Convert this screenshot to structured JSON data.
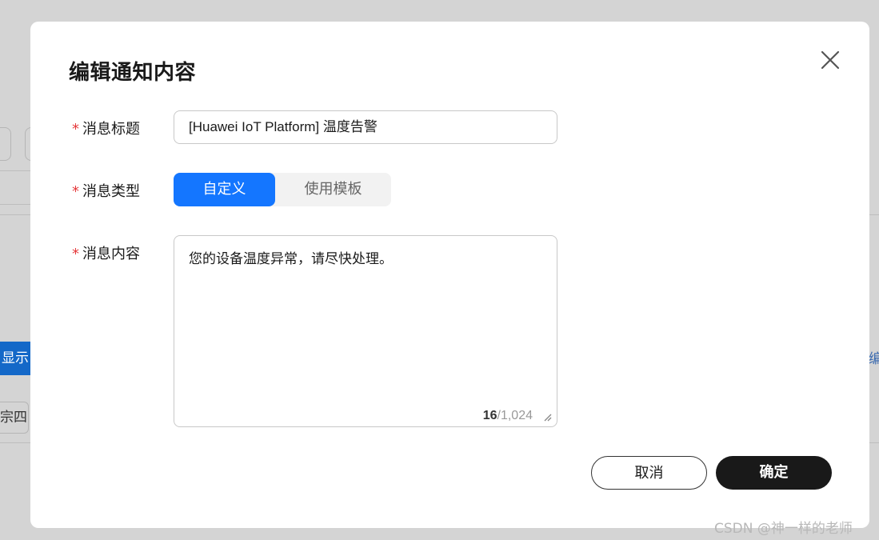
{
  "background": {
    "show_button_label": "显示",
    "name_cell": "宗四",
    "right_link": "编"
  },
  "modal": {
    "title": "编辑通知内容",
    "close_icon": "close-icon",
    "fields": {
      "subject_label": "消息标题",
      "subject_value": "[Huawei IoT Platform] 温度告警",
      "type_label": "消息类型",
      "type_options": [
        "自定义",
        "使用模板"
      ],
      "type_selected": "自定义",
      "content_label": "消息内容",
      "content_value": "您的设备温度异常，请尽快处理。",
      "content_count": "16",
      "content_max": "/1,024"
    },
    "required_mark": "*",
    "buttons": {
      "cancel": "取消",
      "confirm": "确定"
    }
  },
  "watermark": "CSDN @神一样的老师",
  "colors": {
    "primary": "#1476ff",
    "required": "#e5393b",
    "confirm_bg": "#191919"
  }
}
